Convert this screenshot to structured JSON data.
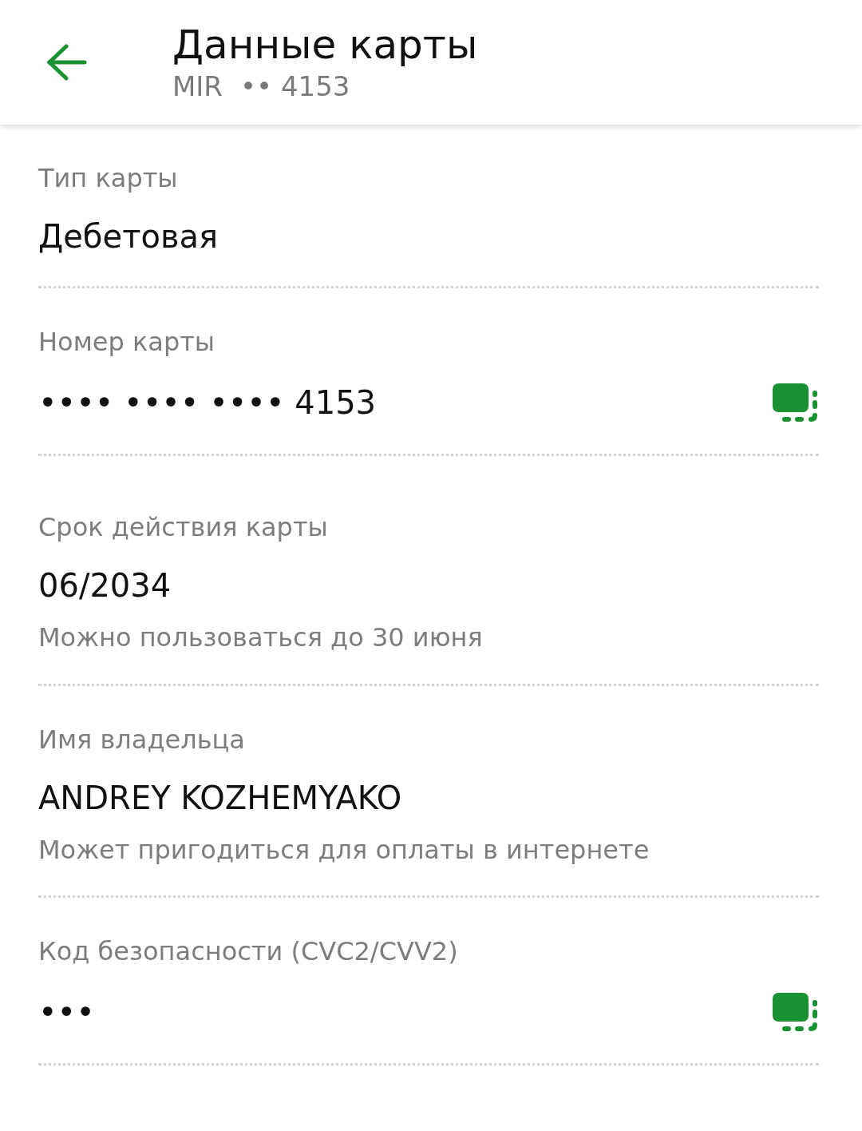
{
  "header": {
    "title": "Данные карты",
    "subtitle_brand": "MIR",
    "subtitle_number": "•• 4153"
  },
  "fields": [
    {
      "label": "Тип карты",
      "value": "Дебетовая",
      "copyable": false
    },
    {
      "label": "Номер карты",
      "value": "•••• •••• •••• 4153",
      "copyable": true
    },
    {
      "label": "Срок действия карты",
      "value": "06/2034",
      "hint": "Можно пользоваться до 30 июня",
      "copyable": false
    },
    {
      "label": "Имя владельца",
      "value": "ANDREY KOZHEMYAKO",
      "hint": "Может пригодиться для оплаты в интернете",
      "copyable": false
    },
    {
      "label": "Код безопасности (CVC2/CVV2)",
      "value": "•••",
      "copyable": true
    }
  ]
}
